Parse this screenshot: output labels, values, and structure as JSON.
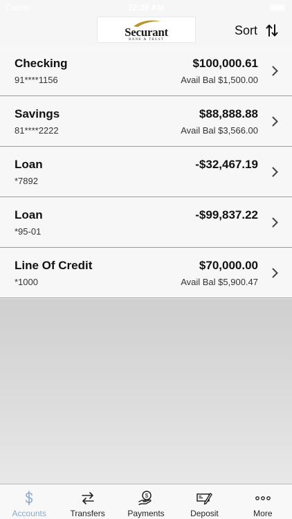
{
  "status_bar": {
    "carrier": "Carrier",
    "time": "12:29 AM"
  },
  "header": {
    "logo_name": "Securant",
    "logo_sub": "BANK & TRUST",
    "sort_label": "Sort",
    "sort_icon": "sort-arrows-icon"
  },
  "accounts": [
    {
      "name": "Checking",
      "number": "91****1156",
      "balance": "$100,000.61",
      "avail": "Avail Bal $1,500.00"
    },
    {
      "name": "Savings",
      "number": "81****2222",
      "balance": "$88,888.88",
      "avail": "Avail Bal $3,566.00"
    },
    {
      "name": "Loan",
      "number": "*7892",
      "balance": "-$32,467.19",
      "avail": ""
    },
    {
      "name": "Loan",
      "number": "*95-01",
      "balance": "-$99,837.22",
      "avail": ""
    },
    {
      "name": "Line Of Credit",
      "number": "*1000",
      "balance": "$70,000.00",
      "avail": "Avail Bal $5,900.47"
    }
  ],
  "tabs": [
    {
      "label": "Accounts",
      "icon": "dollar-icon",
      "active": true
    },
    {
      "label": "Transfers",
      "icon": "transfer-arrows-icon",
      "active": false
    },
    {
      "label": "Payments",
      "icon": "hand-coin-icon",
      "active": false
    },
    {
      "label": "Deposit",
      "icon": "check-deposit-icon",
      "active": false
    },
    {
      "label": "More",
      "icon": "ellipsis-icon",
      "active": false
    }
  ],
  "colors": {
    "accent": "#8aa9c9",
    "logo_gold": "#b8962e",
    "divider": "#9a9a9a"
  }
}
